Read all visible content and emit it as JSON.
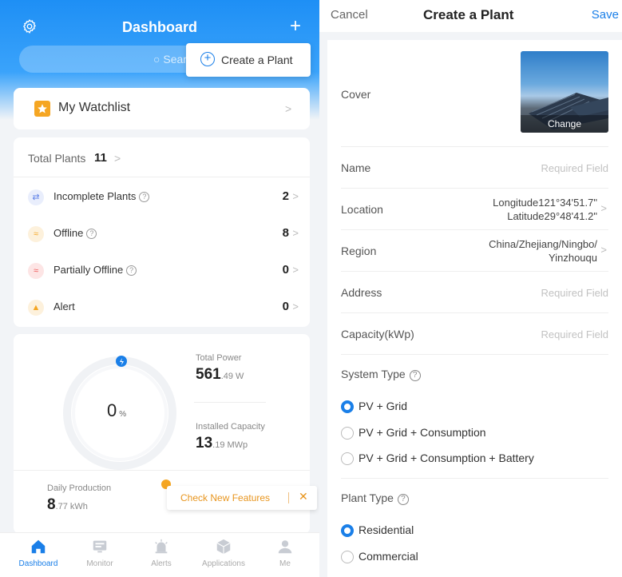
{
  "dashboard": {
    "title": "Dashboard",
    "search_placeholder": "Searc",
    "popup_create_label": "Create a Plant",
    "watchlist_label": "My Watchlist",
    "total_plants_label": "Total Plants",
    "total_plants_count": "11",
    "plants": [
      {
        "label": "Incomplete Plants",
        "value": "2",
        "color": "#5b7fe6"
      },
      {
        "label": "Offline",
        "value": "8",
        "color": "#f5a623"
      },
      {
        "label": "Partially Offline",
        "value": "0",
        "color": "#ef5a5a"
      },
      {
        "label": "Alert",
        "value": "0",
        "color": "#f5a623"
      }
    ],
    "percent_value": "0",
    "percent_unit": "%",
    "total_power_label": "Total Power",
    "total_power_int": "561",
    "total_power_dec": ".49 W",
    "installed_capacity_label": "Installed Capacity",
    "installed_capacity_int": "13",
    "installed_capacity_dec": ".19 MWp",
    "daily_production_label": "Daily Production",
    "daily_production_int": "8",
    "daily_production_dec": ".77 kWh",
    "features_popup_label": "Check New Features",
    "features_close": "✕"
  },
  "tabs": [
    {
      "label": "Dashboard",
      "icon": "home-icon",
      "active": true
    },
    {
      "label": "Monitor",
      "icon": "monitor-icon",
      "active": false
    },
    {
      "label": "Alerts",
      "icon": "alert-icon",
      "active": false
    },
    {
      "label": "Applications",
      "icon": "cube-icon",
      "active": false
    },
    {
      "label": "Me",
      "icon": "user-icon",
      "active": false
    }
  ],
  "form": {
    "cancel_label": "Cancel",
    "title": "Create a Plant",
    "save_label": "Save",
    "cover_label": "Cover",
    "cover_change": "Change",
    "name_label": "Name",
    "name_placeholder": "Required Field",
    "location_label": "Location",
    "location_longitude": "Longitude121°34'51.7\"",
    "location_latitude": "Latitude29°48'41.2\"",
    "region_label": "Region",
    "region_line1": "China/Zhejiang/Ningbo/",
    "region_line2": "Yinzhouqu",
    "address_label": "Address",
    "address_placeholder": "Required Field",
    "capacity_label": "Capacity(kWp)",
    "capacity_placeholder": "Required Field",
    "system_type_label": "System Type",
    "system_types": [
      {
        "label": "PV + Grid",
        "selected": true
      },
      {
        "label": "PV + Grid + Consumption",
        "selected": false
      },
      {
        "label": "PV + Grid + Consumption + Battery",
        "selected": false
      }
    ],
    "plant_type_label": "Plant Type",
    "plant_types": [
      {
        "label": "Residential",
        "selected": true
      },
      {
        "label": "Commercial",
        "selected": false
      }
    ]
  },
  "colors": {
    "brand_blue": "#1a7fe8",
    "warning_orange": "#e8951e"
  }
}
